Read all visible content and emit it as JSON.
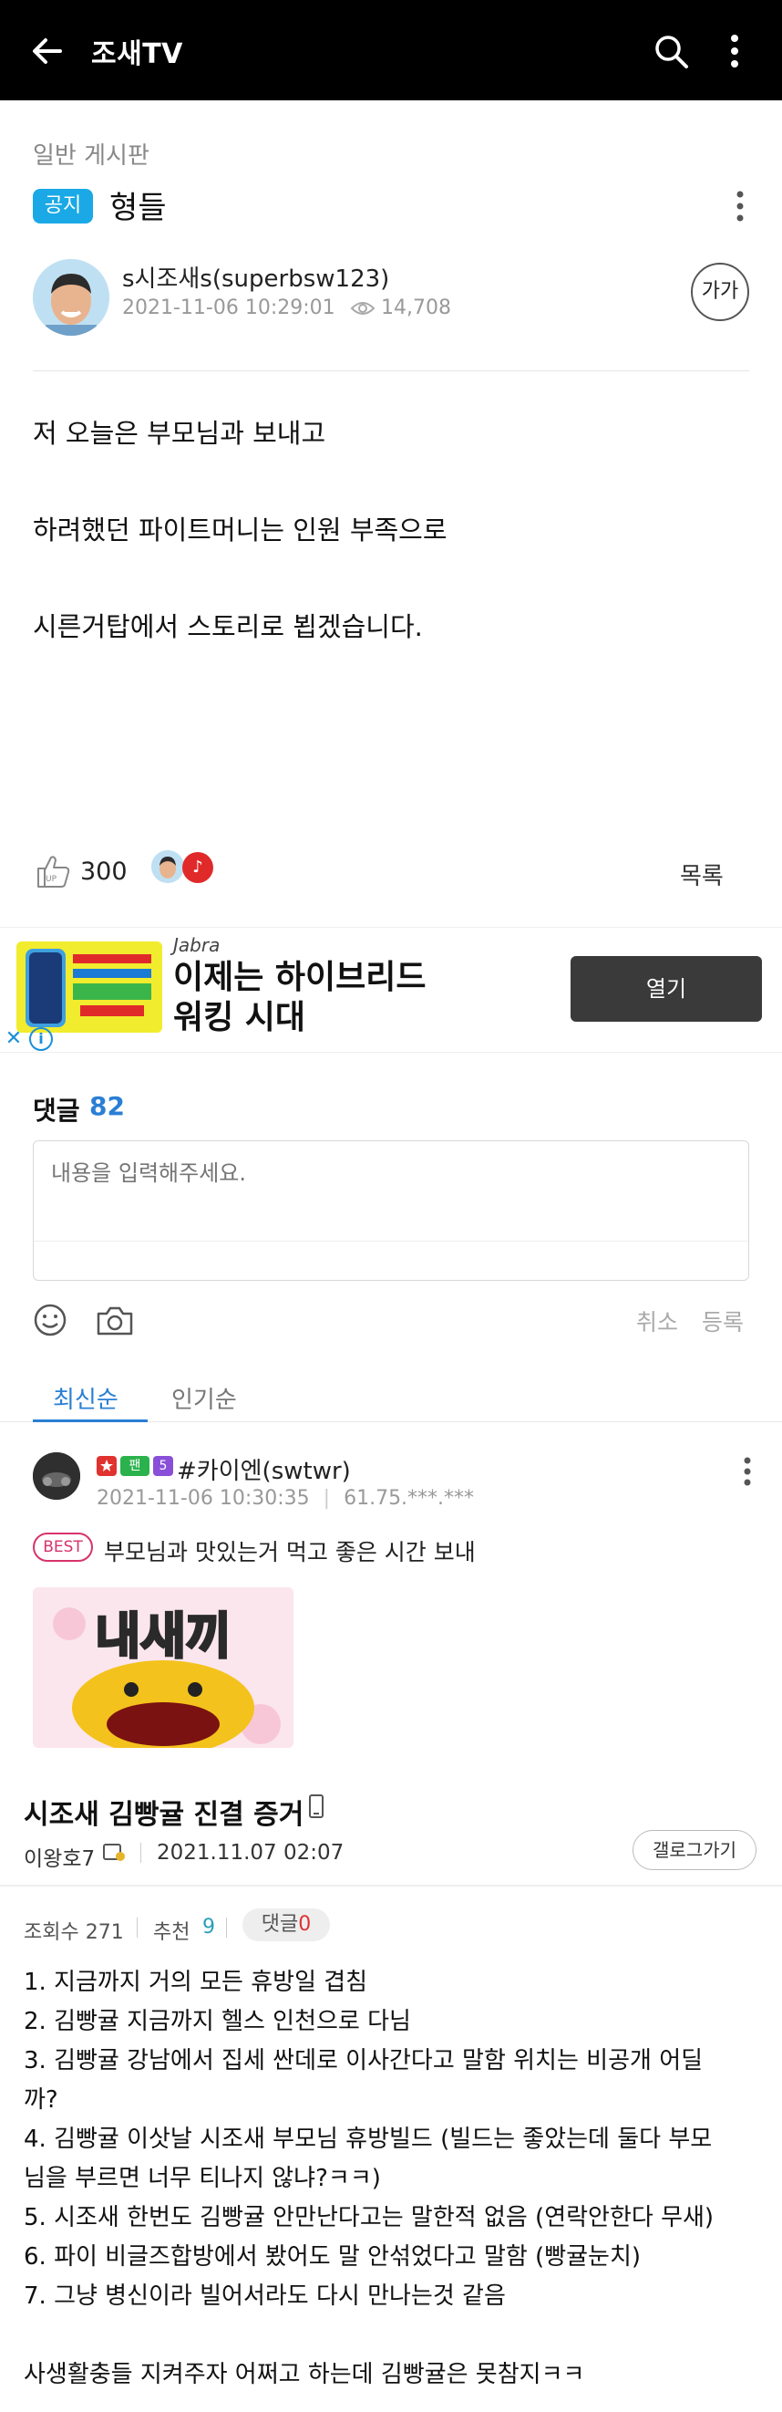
{
  "app": {
    "title": "조새TV"
  },
  "post": {
    "board": "일반 게시판",
    "badge": "공지",
    "title": "형들",
    "author": "s시조새s(superbsw123)",
    "date": "2021-11-06 10:29:01",
    "views": "14,708",
    "font_button": "가가",
    "body": [
      "저 오늘은  부모님과 보내고",
      "하려했던 파이트머니는 인원 부족으로",
      "시른거탑에서 스토리로 뵙겠습니다."
    ],
    "like_count": "300",
    "liker_badge": "♪",
    "list_button": "목록"
  },
  "ad": {
    "brand": "Jabra",
    "headline_1": "이제는 하이브리드",
    "headline_2": "워킹 시대",
    "button": "열기",
    "close": "✕",
    "info": "i"
  },
  "comments": {
    "label": "댓글",
    "count": "82",
    "placeholder": "내용을 입력해주세요.",
    "cancel": "취소",
    "submit": "등록",
    "tabs": [
      "최신순",
      "인기순"
    ],
    "items": [
      {
        "badge_fan": "팬",
        "badge_level": "5",
        "name": "#카이엔(swtwr)",
        "date": "2021-11-06 10:30:35",
        "ip": "61.75.***.***",
        "best": "BEST",
        "text": "부모님과 맛있는거 먹고 좋은 시간 보내",
        "sticker_text": "내새끼"
      }
    ]
  },
  "post2": {
    "title": "시조새 김빵귤 진결 증거",
    "author": "이왕호7",
    "date": "2021.11.07 02:07",
    "gallery_button": "갤로그가기",
    "views_label": "조회수 271",
    "rec_label": "추천",
    "rec_value": "9",
    "comments_label": "댓글",
    "comments_value": "0",
    "lines": [
      "1. 지금까지 거의 모든 휴방일 겹침",
      "2. 김빵귤 지금까지 헬스 인천으로 다님",
      "3. 김빵귤 강남에서 집세 싼데로 이사간다고 말함 위치는 비공개 어딜",
      "까?",
      "4. 김빵귤 이삿날 시조새 부모님 휴방빌드 (빌드는 좋았는데 둘다 부모",
      "님을 부르면 너무 티나지 않냐?ㅋㅋ)",
      "5. 시조새 한번도 김빵귤 안만난다고는 말한적 없음 (연락안한다 무새)",
      "6. 파이 비글즈합방에서 봤어도 말 안섞었다고 말함 (빵귤눈치)",
      "7. 그냥 병신이라 빌어서라도 다시 만나는것 같음",
      "사생활충들 지켜주자 어쩌고 하는데 김빵귤은 못참지ㅋㅋ"
    ]
  },
  "colors": {
    "accent_blue": "#2a7fd4",
    "notice_badge": "#1aa9e6",
    "topbar": "#000000"
  }
}
